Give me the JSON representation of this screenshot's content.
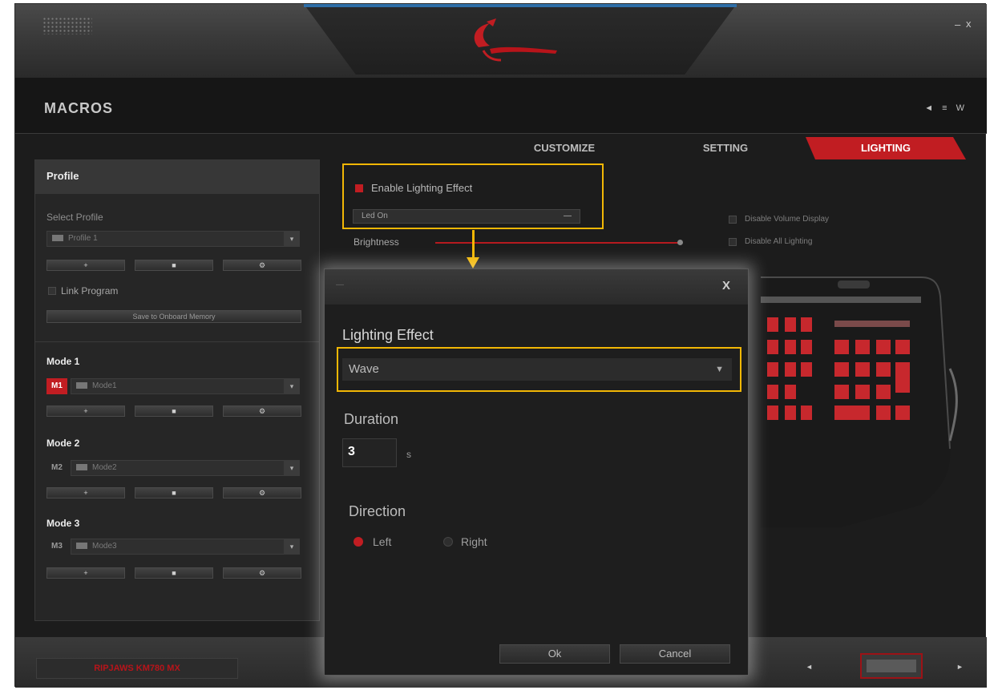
{
  "window": {
    "title": "MACROS",
    "language_icons": "◄ ≡ W",
    "minimize_label": "–",
    "close_label": "x"
  },
  "tabs": [
    {
      "label": "CUSTOMIZE",
      "active": false
    },
    {
      "label": "SETTING",
      "active": false
    },
    {
      "label": "LIGHTING",
      "active": true
    }
  ],
  "sidebar": {
    "header": "Profile",
    "select_profile_label": "Select Profile",
    "profile_value": "Profile 1",
    "link_program_label": "Link Program",
    "save_button": "Save to Onboard Memory",
    "modes": [
      {
        "title": "Mode 1",
        "badge": "M1",
        "value": "Mode1",
        "active": true
      },
      {
        "title": "Mode 2",
        "badge": "M2",
        "value": "Mode2",
        "active": false
      },
      {
        "title": "Mode 3",
        "badge": "M3",
        "value": "Mode3",
        "active": false
      }
    ],
    "row_buttons": [
      "+",
      "■",
      "⚙"
    ]
  },
  "lighting": {
    "enable_label": "Enable Lighting Effect",
    "enable_checked": true,
    "led_select_value": "Led On",
    "brightness_label": "Brightness",
    "brightness_level": 1.0,
    "options": [
      {
        "label": "Disable Volume Display",
        "checked": false
      },
      {
        "label": "Disable All Lighting",
        "checked": false
      }
    ]
  },
  "dialog": {
    "title": "—",
    "close_label": "X",
    "effect_label": "Lighting Effect",
    "effect_value": "Wave",
    "duration_label": "Duration",
    "duration_value": "3",
    "duration_unit": "s",
    "direction_label": "Direction",
    "direction_left": "Left",
    "direction_right": "Right",
    "direction_selected": "Left",
    "ok_label": "Ok",
    "cancel_label": "Cancel"
  },
  "footer": {
    "device_name": "RIPJAWS KM780 MX",
    "prev_icon": "◄",
    "next_icon": "►"
  },
  "colors": {
    "accent_red": "#c11d22",
    "highlight_yellow": "#f2b705",
    "background": "#1c1c1c"
  }
}
